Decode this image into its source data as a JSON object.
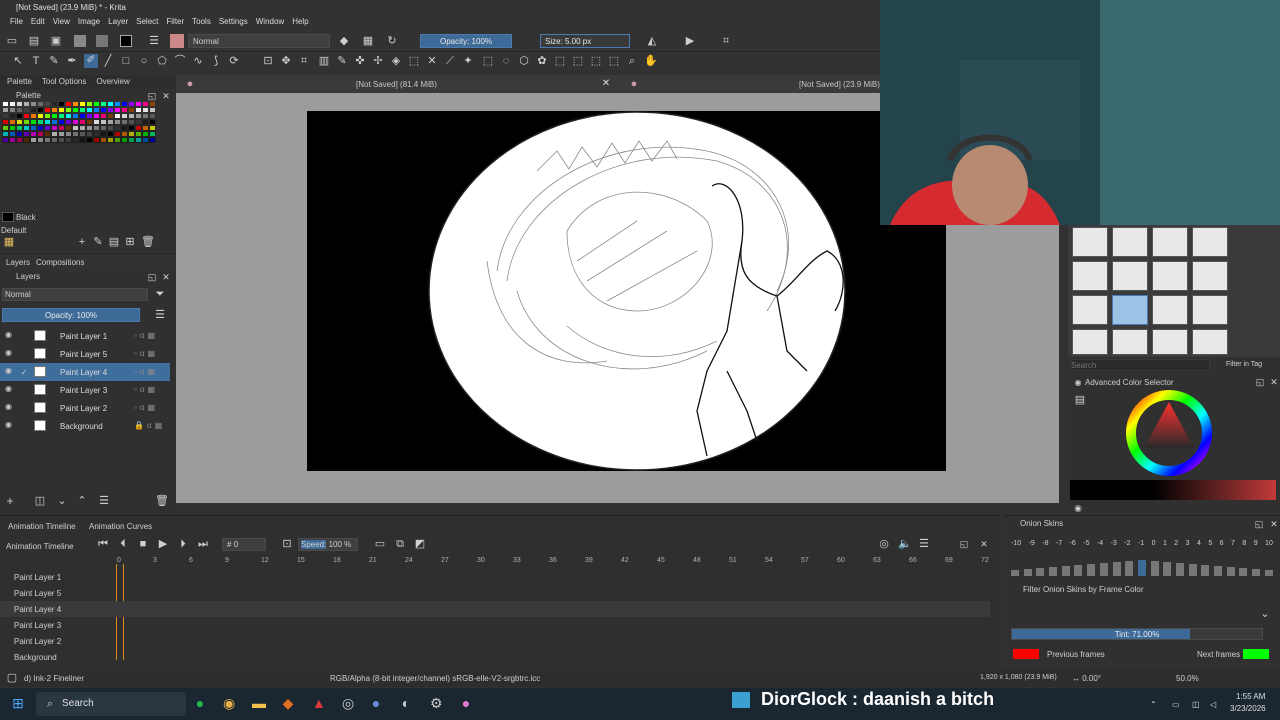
{
  "window": {
    "title": "[Not Saved]  (23.9 MiB) * - Krita"
  },
  "menu": [
    "File",
    "Edit",
    "View",
    "Image",
    "Layer",
    "Select",
    "Filter",
    "Tools",
    "Settings",
    "Window",
    "Help"
  ],
  "toolbar": {
    "blend_mode": "Normal",
    "opacity": "Opacity: 100%",
    "size": "Size: 5.00 px"
  },
  "left_tabs": [
    "Palette",
    "Tool Options",
    "Overview"
  ],
  "palette": {
    "title": "Palette",
    "current_color_name": "Black",
    "palette_name": "Default",
    "swatch_colors": [
      "#ffffff",
      "#e0e0e0",
      "#c0c0c0",
      "#a0a0a0",
      "#808080",
      "#606060",
      "#404040",
      "#202020",
      "#000000",
      "#ff0000",
      "#ff8000",
      "#ffff00",
      "#80ff00",
      "#00ff00",
      "#00ff80",
      "#00ffff",
      "#0080ff",
      "#0000ff",
      "#8000ff",
      "#ff00ff",
      "#ff0080",
      "#804000"
    ]
  },
  "layers_tabs": [
    "Layers",
    "Compositions"
  ],
  "layers": {
    "title": "Layers",
    "blend_mode": "Normal",
    "opacity": "Opacity:  100%",
    "items": [
      {
        "name": "Paint Layer 1",
        "active": false
      },
      {
        "name": "Paint Layer 5",
        "active": false
      },
      {
        "name": "Paint Layer 4",
        "active": true
      },
      {
        "name": "Paint Layer 3",
        "active": false
      },
      {
        "name": "Paint Layer 2",
        "active": false
      },
      {
        "name": "Background",
        "active": false
      }
    ]
  },
  "canvas_tabs": [
    {
      "label": "[Not Saved]  (81.4 MiB)"
    },
    {
      "label": "[Not Saved]  (23.9 MiB)"
    }
  ],
  "brushes_panel": {
    "search_placeholder": "Search",
    "filter_label": "Filter in Tag"
  },
  "color_selector": {
    "title": "Advanced Color Selector"
  },
  "timeline": {
    "tabs": [
      "Animation Timeline",
      "Animation Curves"
    ],
    "title": "Animation Timeline",
    "current_frame": "0",
    "speed_label": "Speed:",
    "speed_value": "100 %",
    "frame_numbers": [
      "0",
      "3",
      "6",
      "9",
      "12",
      "15",
      "18",
      "21",
      "24",
      "27",
      "30",
      "33",
      "36",
      "39",
      "42",
      "45",
      "48",
      "51",
      "54",
      "57",
      "60",
      "63",
      "66",
      "69",
      "72"
    ],
    "rows": [
      "Paint Layer 1",
      "Paint Layer 5",
      "Paint Layer 4",
      "Paint Layer 3",
      "Paint Layer 2",
      "Background"
    ]
  },
  "onion": {
    "title": "Onion Skins",
    "numbers": [
      "-10",
      "-9",
      "-8",
      "-7",
      "-6",
      "-5",
      "-4",
      "-3",
      "-2",
      "-1",
      "0",
      "1",
      "2",
      "3",
      "4",
      "5",
      "6",
      "7",
      "8",
      "9",
      "10"
    ],
    "filter_label": "Filter Onion Skins by Frame Color",
    "tint": "Tint: 71.00%",
    "tint_fraction": 0.71,
    "previous_label": "Previous frames",
    "next_label": "Next frames",
    "previous_color": "#ff0000",
    "next_color": "#00ff00"
  },
  "status": {
    "brush": "d) Ink-2 Fineliner",
    "color_space": "RGB/Alpha (8-bit integer/channel)  sRGB-elle-V2-srgbtrc.icc",
    "dims": "1,920 x 1,080 (23.9 MiB)",
    "rotation": "0.00°",
    "zoom": "50.0%"
  },
  "taskbar": {
    "search": "Search",
    "time": "1:55 AM",
    "date": "3/23/2026"
  },
  "overlay_chat": "DiorGlock : daanish a bitch"
}
